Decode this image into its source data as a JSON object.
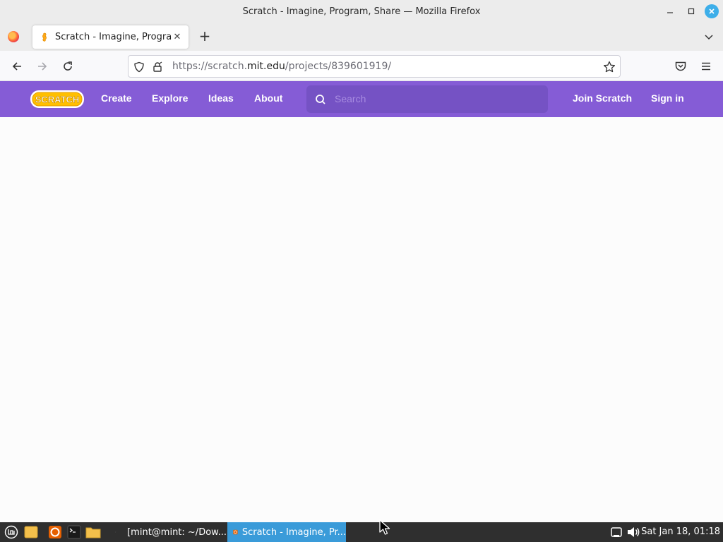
{
  "window": {
    "title": "Scratch - Imagine, Program, Share — Mozilla Firefox",
    "minimize_icon": "minimize-icon",
    "maximize_icon": "maximize-icon",
    "close_icon": "close-icon"
  },
  "tabs": [
    {
      "label": "Scratch - Imagine, Program, Share",
      "active": true
    }
  ],
  "toolbar": {
    "url_prefix": "https://scratch.",
    "url_host": "mit.edu",
    "url_path": "/projects/839601919/"
  },
  "scratch": {
    "logo_text": "SCRATCH",
    "nav": [
      "Create",
      "Explore",
      "Ideas",
      "About"
    ],
    "search_placeholder": "Search",
    "join": "Join Scratch",
    "signin": "Sign in",
    "brand_color": "#855cd6"
  },
  "taskbar": {
    "tasks": [
      {
        "label": "[mint@mint: ~/Dow...",
        "active": false
      },
      {
        "label": "Scratch - Imagine, Pr...",
        "active": true
      }
    ],
    "clock": "Sat Jan 18, 01:18"
  }
}
